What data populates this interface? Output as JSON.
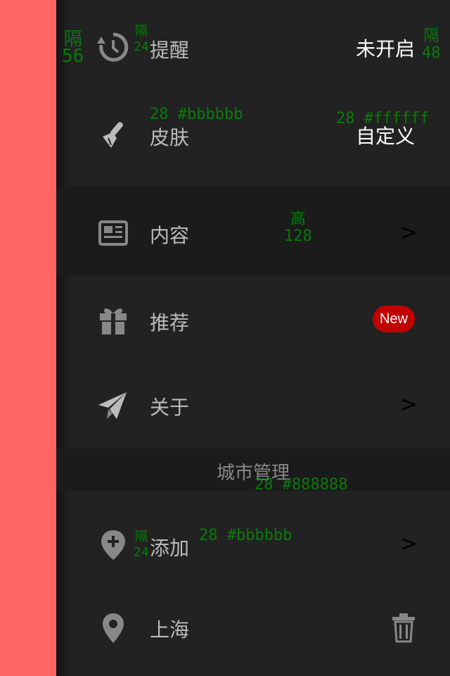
{
  "settings": {
    "reminder": {
      "label": "提醒",
      "value": "未开启",
      "icon": "history-clock-icon"
    },
    "skin": {
      "label": "皮肤",
      "value": "自定义",
      "icon": "paint-brush-icon"
    },
    "content": {
      "label": "内容",
      "chevron": ">",
      "icon": "newspaper-icon"
    },
    "recommend": {
      "label": "推荐",
      "badge": "New",
      "icon": "gift-icon"
    },
    "about": {
      "label": "关于",
      "chevron": ">",
      "icon": "paper-plane-icon"
    }
  },
  "city_section": {
    "title": "城市管理",
    "add": {
      "label": "添加",
      "chevron": ">",
      "icon": "add-location-icon"
    },
    "city": {
      "label": "上海",
      "icon": "location-pin-icon",
      "delete_icon": "trash-icon"
    }
  },
  "annotations": {
    "spacing_56": "隔\n56",
    "spacing_24_top": "隔\n24",
    "spacing_48": "隔\n48",
    "skin_label_spec": "28 #bbbbbb",
    "skin_value_spec": "28 #ffffff",
    "row_height": "高\n128",
    "section_spec": "28 #888888",
    "add_label_spec": "28 #bbbbbb",
    "spacing_24_bottom": "隔\n24"
  },
  "colors": {
    "accent_strip": "#ff6464",
    "panel_bg": "#222222",
    "highlight_row": "#1b1b1b",
    "label": "#bbbbbb",
    "value": "#ffffff",
    "section_title": "#888888",
    "badge": "#c00000",
    "annotation": "#0a7a0a"
  }
}
